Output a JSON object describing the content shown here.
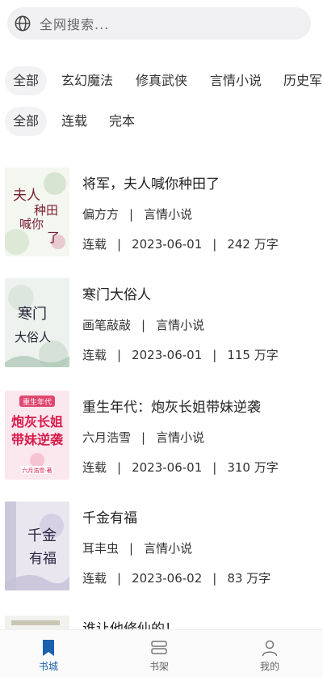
{
  "search": {
    "placeholder": "全网搜索..."
  },
  "genre_filters": [
    {
      "label": "全部",
      "active": true
    },
    {
      "label": "玄幻魔法",
      "active": false
    },
    {
      "label": "修真武侠",
      "active": false
    },
    {
      "label": "言情小说",
      "active": false
    },
    {
      "label": "历史军",
      "active": false
    }
  ],
  "status_filters": [
    {
      "label": "全部",
      "active": true
    },
    {
      "label": "连载",
      "active": false
    },
    {
      "label": "完本",
      "active": false
    }
  ],
  "books": [
    {
      "title": "将军，夫人喊你种田了",
      "author": "偏方方",
      "category": "言情小说",
      "status": "连载",
      "date": "2023-06-01",
      "words": "242 万字",
      "cover_text": [
        "夫人",
        "种田",
        "喊你",
        "了"
      ]
    },
    {
      "title": "寒门大俗人",
      "author": "画笔敲敲",
      "category": "言情小说",
      "status": "连载",
      "date": "2023-06-01",
      "words": "115 万字",
      "cover_text": [
        "寒门",
        "大俗人"
      ]
    },
    {
      "title": "重生年代：炮灰长姐带妹逆袭",
      "author": "六月浩雪",
      "category": "言情小说",
      "status": "连载",
      "date": "2023-06-01",
      "words": "310 万字",
      "cover_text": [
        "重生年代",
        "炮灰长姐",
        "带妹逆袭",
        "六月浩雪·著"
      ]
    },
    {
      "title": "千金有福",
      "author": "耳丰虫",
      "category": "言情小说",
      "status": "连载",
      "date": "2023-06-02",
      "words": "83 万字",
      "cover_text": [
        "千金",
        "有福"
      ]
    },
    {
      "title": "谁让他修仙的！"
    }
  ],
  "tabbar": {
    "items": [
      {
        "label": "书城",
        "active": true,
        "icon": "bookmark-icon"
      },
      {
        "label": "书架",
        "active": false,
        "icon": "bookshelf-icon"
      },
      {
        "label": "我的",
        "active": false,
        "icon": "person-icon"
      }
    ]
  },
  "colors": {
    "accent": "#1b5fad",
    "chip_bg": "#f2f2f4",
    "search_bg": "#f0f0f2"
  }
}
